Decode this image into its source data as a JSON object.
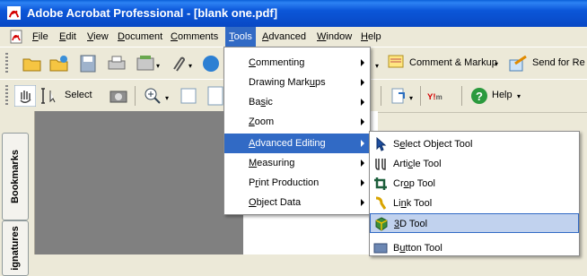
{
  "window": {
    "title": "Adobe Acrobat Professional - [blank one.pdf]"
  },
  "menubar": {
    "items": [
      {
        "pre": "",
        "u": "F",
        "post": "ile"
      },
      {
        "pre": "",
        "u": "E",
        "post": "dit"
      },
      {
        "pre": "",
        "u": "V",
        "post": "iew"
      },
      {
        "pre": "",
        "u": "D",
        "post": "ocument"
      },
      {
        "pre": "",
        "u": "C",
        "post": "omments"
      },
      {
        "pre": "",
        "u": "T",
        "post": "ools"
      },
      {
        "pre": "",
        "u": "A",
        "post": "dvanced"
      },
      {
        "pre": "",
        "u": "W",
        "post": "indow"
      },
      {
        "pre": "",
        "u": "H",
        "post": "elp"
      }
    ]
  },
  "toolbar1": {
    "comment_markup": "Comment & Markup",
    "send_for_review": "Send for Re"
  },
  "toolbar2": {
    "select": "Select",
    "help": "Help"
  },
  "left_panel": {
    "tabs": [
      "Bookmarks",
      "ignatures"
    ]
  },
  "tools_menu": {
    "items": [
      {
        "pre": "",
        "u": "C",
        "post": "ommenting",
        "submenu": true
      },
      {
        "pre": "Drawing Mark",
        "u": "u",
        "post": "ps",
        "submenu": true
      },
      {
        "pre": "Ba",
        "u": "s",
        "post": "ic",
        "submenu": true
      },
      {
        "pre": "",
        "u": "Z",
        "post": "oom",
        "submenu": true
      },
      {
        "pre": "",
        "u": "A",
        "post": "dvanced Editing",
        "submenu": true,
        "highlighted": true
      },
      {
        "pre": "",
        "u": "M",
        "post": "easuring",
        "submenu": true
      },
      {
        "pre": "P",
        "u": "r",
        "post": "int Production",
        "submenu": true
      },
      {
        "pre": "",
        "u": "O",
        "post": "bject Data",
        "submenu": true
      }
    ]
  },
  "advanced_editing_submenu": {
    "items": [
      {
        "pre": "S",
        "u": "e",
        "post": "lect Object Tool",
        "icon": "arrow-cursor-icon"
      },
      {
        "pre": "Arti",
        "u": "c",
        "post": "le Tool",
        "icon": "article-tool-icon"
      },
      {
        "pre": "Cr",
        "u": "o",
        "post": "p Tool",
        "icon": "crop-tool-icon"
      },
      {
        "pre": "Li",
        "u": "n",
        "post": "k Tool",
        "icon": "link-tool-icon"
      },
      {
        "pre": "",
        "u": "3",
        "post": "D Tool",
        "icon": "3d-tool-icon",
        "highlighted": true
      },
      {
        "pre": "B",
        "u": "u",
        "post": "tton Tool",
        "icon": "button-tool-icon"
      }
    ]
  },
  "colors": {
    "title_bar": "#0a5fd8",
    "menu_highlight": "#316ac5",
    "hover_highlight": "#c1d2ee",
    "chrome": "#ece9d8"
  }
}
